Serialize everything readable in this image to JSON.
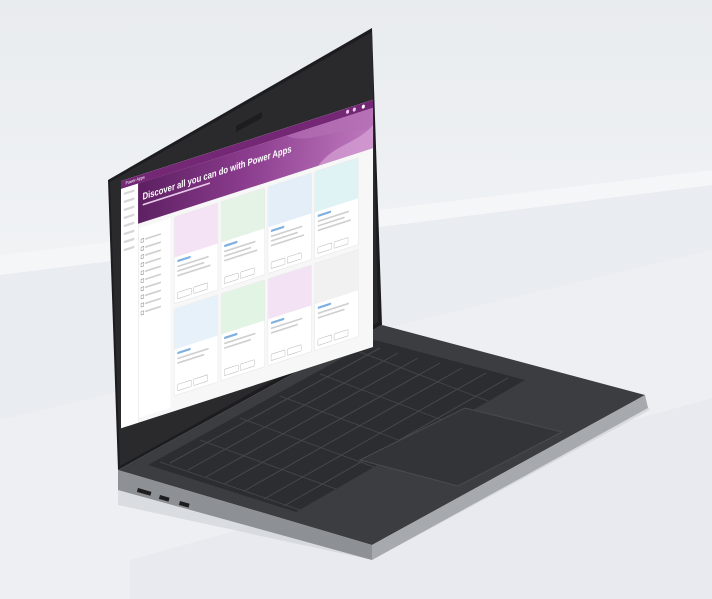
{
  "scene": {
    "description_type": "product-photo",
    "laptop_color": "#3a3b3e",
    "bezel_color": "#1b1b1d",
    "background_color": "#eceff2"
  },
  "screen": {
    "app_bar_title": "Power Apps",
    "hero_title": "Discover all you can do with Power Apps",
    "accent_color": "#742774"
  }
}
